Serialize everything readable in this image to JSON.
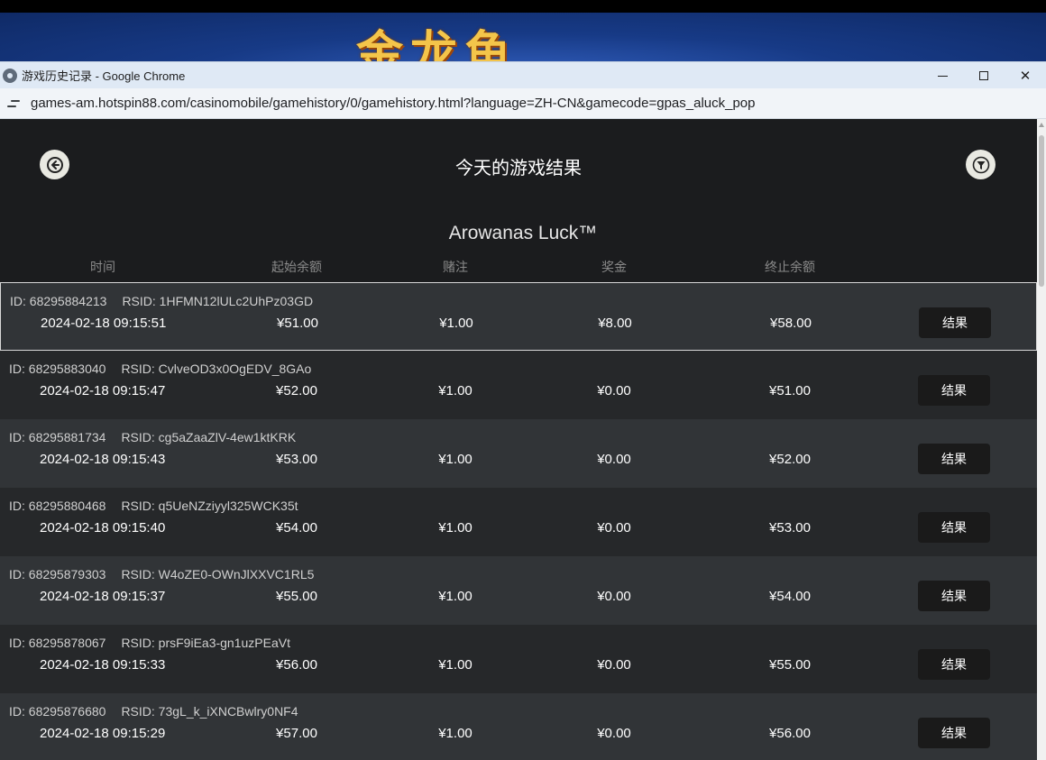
{
  "banner": {
    "title": "金龙鱼"
  },
  "window": {
    "title": "游戏历史记录 - Google Chrome",
    "controls": {
      "minimize": "",
      "maximize": "",
      "close": "✕"
    }
  },
  "address": {
    "url": "games-am.hotspin88.com/casinomobile/gamehistory/0/gamehistory.html?language=ZH-CN&gamecode=gpas_aluck_pop"
  },
  "header": {
    "title": "今天的游戏结果"
  },
  "game": {
    "name": "Arowanas Luck™"
  },
  "columns": {
    "time": "时间",
    "start_balance": "起始余额",
    "bet": "赌注",
    "win": "奖金",
    "end_balance": "终止余额"
  },
  "rows": [
    {
      "id_label": "ID:",
      "id": "68295884213",
      "rsid_label": "RSID:",
      "rsid": "1HFMN12lULc2UhPz03GD",
      "time": "2024-02-18 09:15:51",
      "start": "¥51.00",
      "bet": "¥1.00",
      "win": "¥8.00",
      "end": "¥58.00",
      "button": "结果"
    },
    {
      "id_label": "ID:",
      "id": "68295883040",
      "rsid_label": "RSID:",
      "rsid": "CvlveOD3x0OgEDV_8GAo",
      "time": "2024-02-18 09:15:47",
      "start": "¥52.00",
      "bet": "¥1.00",
      "win": "¥0.00",
      "end": "¥51.00",
      "button": "结果"
    },
    {
      "id_label": "ID:",
      "id": "68295881734",
      "rsid_label": "RSID:",
      "rsid": "cg5aZaaZlV-4ew1ktKRK",
      "time": "2024-02-18 09:15:43",
      "start": "¥53.00",
      "bet": "¥1.00",
      "win": "¥0.00",
      "end": "¥52.00",
      "button": "结果"
    },
    {
      "id_label": "ID:",
      "id": "68295880468",
      "rsid_label": "RSID:",
      "rsid": "q5UeNZziyyl325WCK35t",
      "time": "2024-02-18 09:15:40",
      "start": "¥54.00",
      "bet": "¥1.00",
      "win": "¥0.00",
      "end": "¥53.00",
      "button": "结果"
    },
    {
      "id_label": "ID:",
      "id": "68295879303",
      "rsid_label": "RSID:",
      "rsid": "W4oZE0-OWnJlXXVC1RL5",
      "time": "2024-02-18 09:15:37",
      "start": "¥55.00",
      "bet": "¥1.00",
      "win": "¥0.00",
      "end": "¥54.00",
      "button": "结果"
    },
    {
      "id_label": "ID:",
      "id": "68295878067",
      "rsid_label": "RSID:",
      "rsid": "prsF9iEa3-gn1uzPEaVt",
      "time": "2024-02-18 09:15:33",
      "start": "¥56.00",
      "bet": "¥1.00",
      "win": "¥0.00",
      "end": "¥55.00",
      "button": "结果"
    },
    {
      "id_label": "ID:",
      "id": "68295876680",
      "rsid_label": "RSID:",
      "rsid": "73gL_k_iXNCBwlry0NF4",
      "time": "2024-02-18 09:15:29",
      "start": "¥57.00",
      "bet": "¥1.00",
      "win": "¥0.00",
      "end": "¥56.00",
      "button": "结果"
    }
  ]
}
